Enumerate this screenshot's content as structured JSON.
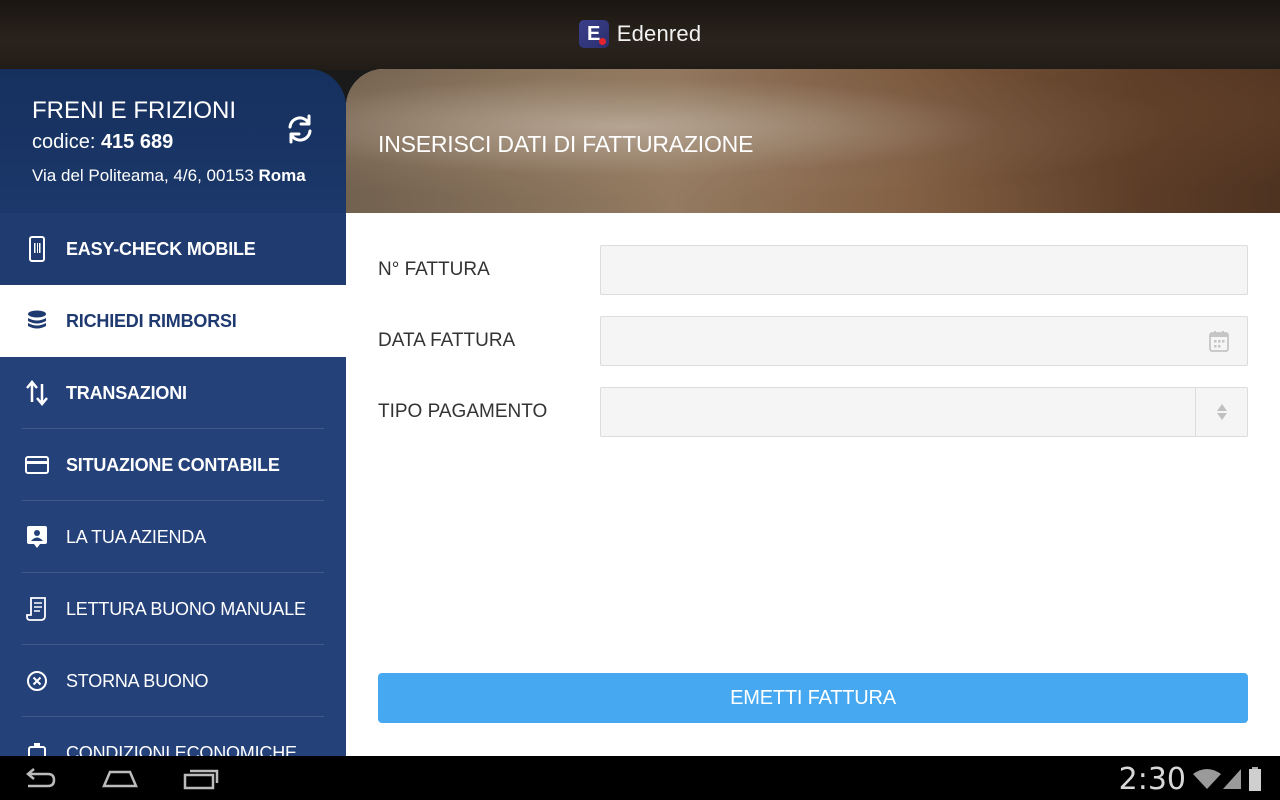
{
  "app": {
    "brand_name": "Edenred",
    "brand_letter": "E"
  },
  "profile": {
    "name": "FRENI E FRIZIONI",
    "code_label": "codice: ",
    "code_value": "415 689",
    "address": "Via del Politeama, 4/6, 00153 ",
    "city": "Roma"
  },
  "menu": [
    {
      "label": "EASY-CHECK MOBILE",
      "icon": "smartphone-icon"
    },
    {
      "label": "RICHIEDI RIMBORSI",
      "icon": "coins-icon"
    },
    {
      "label": "TRANSAZIONI",
      "icon": "transfer-arrows-icon"
    },
    {
      "label": "SITUAZIONE CONTABILE",
      "icon": "credit-card-icon"
    },
    {
      "label": "LA TUA AZIENDA",
      "icon": "company-badge-icon"
    },
    {
      "label": "LETTURA BUONO MANUALE",
      "icon": "receipt-icon"
    },
    {
      "label": "STORNA BUONO",
      "icon": "cancel-circle-icon"
    },
    {
      "label": "CONDIZIONI ECONOMICHE",
      "icon": "conditions-icon"
    }
  ],
  "main": {
    "title": "INSERISCI DATI DI FATTURAZIONE",
    "fields": {
      "invoice_number_label": "N° FATTURA",
      "invoice_date_label": "DATA FATTURA",
      "payment_type_label": "TIPO PAGAMENTO"
    },
    "submit_label": "EMETTI FATTURA"
  },
  "status": {
    "time": "2:30"
  },
  "colors": {
    "sidebar": "#24417a",
    "accent": "#45a8f1",
    "active_text": "#1f3a70"
  }
}
